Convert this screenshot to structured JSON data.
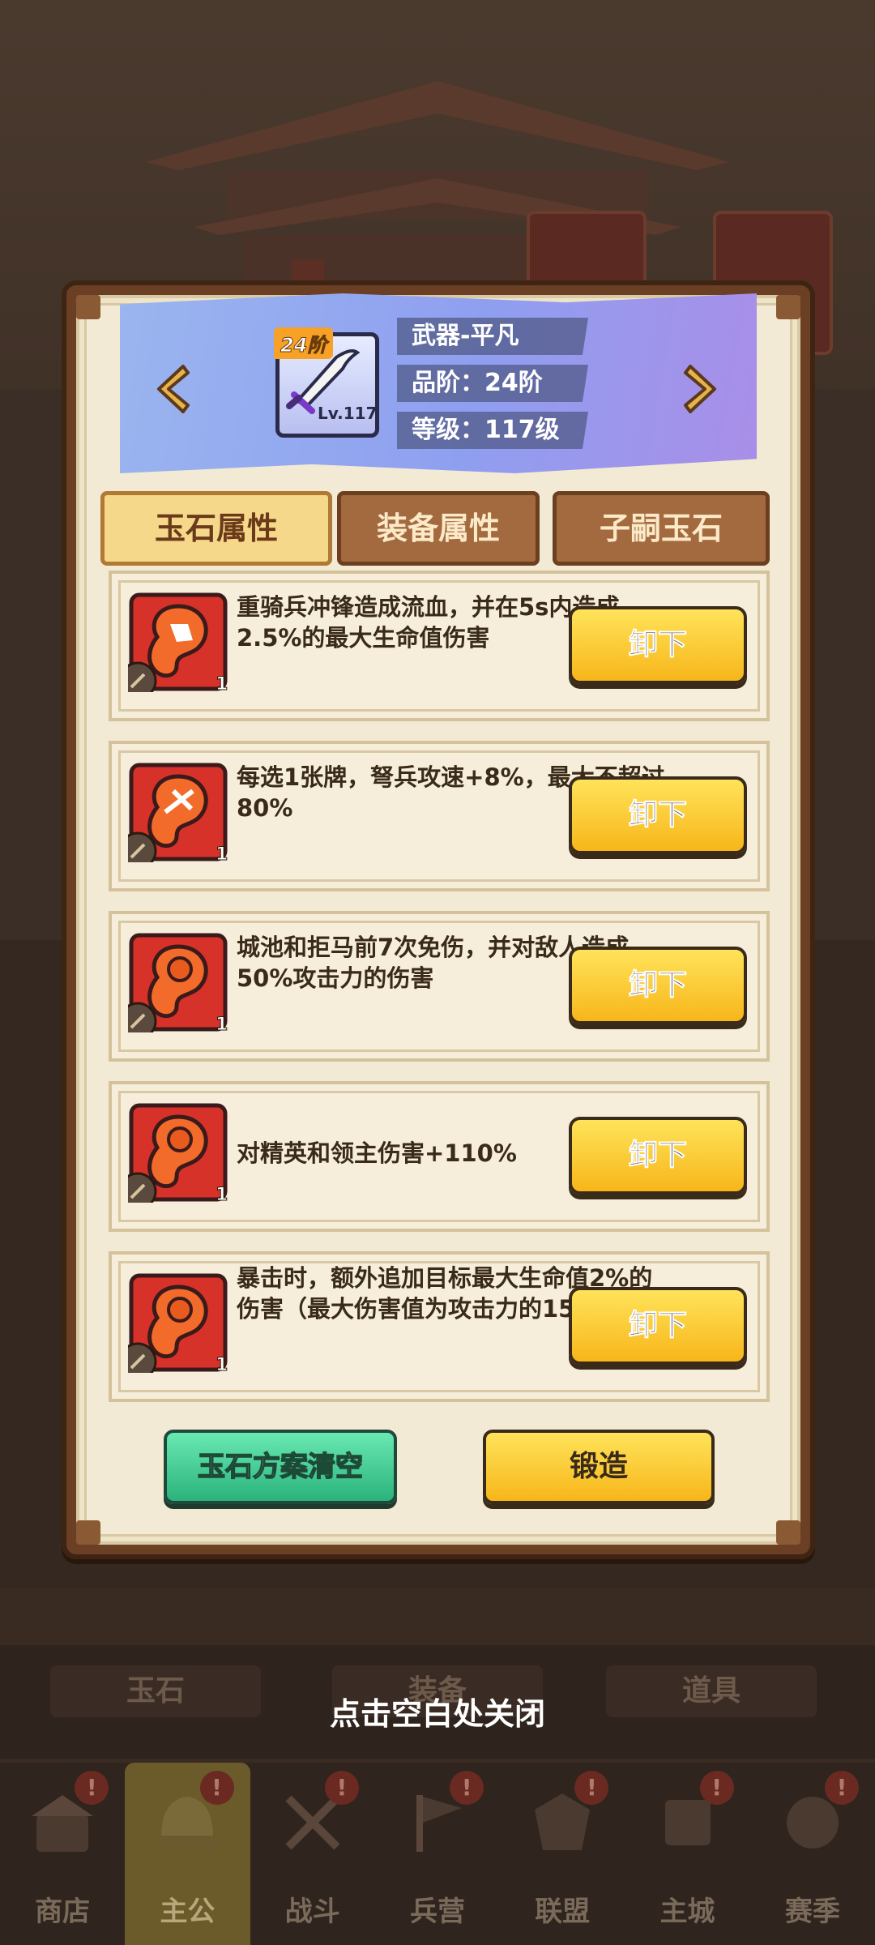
{
  "item": {
    "tier_tag": "24阶",
    "level_tag": "Lv.117",
    "name": "武器-平凡",
    "grade": "品阶：24阶",
    "level": "等级：117级"
  },
  "tabs": [
    {
      "label": "玉石属性",
      "active": true
    },
    {
      "label": "装备属性",
      "active": false
    },
    {
      "label": "子嗣玉石",
      "active": false
    }
  ],
  "gems": [
    {
      "text": "重骑兵冲锋造成流血，并在5s内造成2.5%的最大生命值伤害",
      "count": "1",
      "button": "卸下",
      "icon": "horse-gem-icon"
    },
    {
      "text": "每选1张牌，弩兵攻速+8%，最大不超过80%",
      "count": "1",
      "button": "卸下",
      "icon": "crossbow-gem-icon"
    },
    {
      "text": "城池和拒马前7次免伤，并对敌人造成50%攻击力的伤害",
      "count": "1",
      "button": "卸下",
      "icon": "city-gem-icon"
    },
    {
      "text": "对精英和领主伤害+110%",
      "count": "1",
      "button": "卸下",
      "icon": "plain-gem-icon"
    },
    {
      "text": "暴击时，额外追加目标最大生命值2%的伤害（最大伤害值为攻击力的1500%）",
      "count": "1",
      "button": "卸下",
      "icon": "crit-gem-icon"
    }
  ],
  "actions": {
    "clear": "玉石方案清空",
    "forge": "锻造"
  },
  "close_hint": "点击空白处关闭",
  "background": {
    "tabs": [
      "玉石",
      "装备",
      "道具"
    ],
    "nav": [
      "商店",
      "主公",
      "战斗",
      "兵营",
      "联盟",
      "主城",
      "赛季"
    ]
  },
  "colors": {
    "accent_yellow": "#f7b61a",
    "accent_green": "#2bb37c",
    "banner_blue": "#9ab5ef",
    "gem_red": "#d7322a"
  }
}
